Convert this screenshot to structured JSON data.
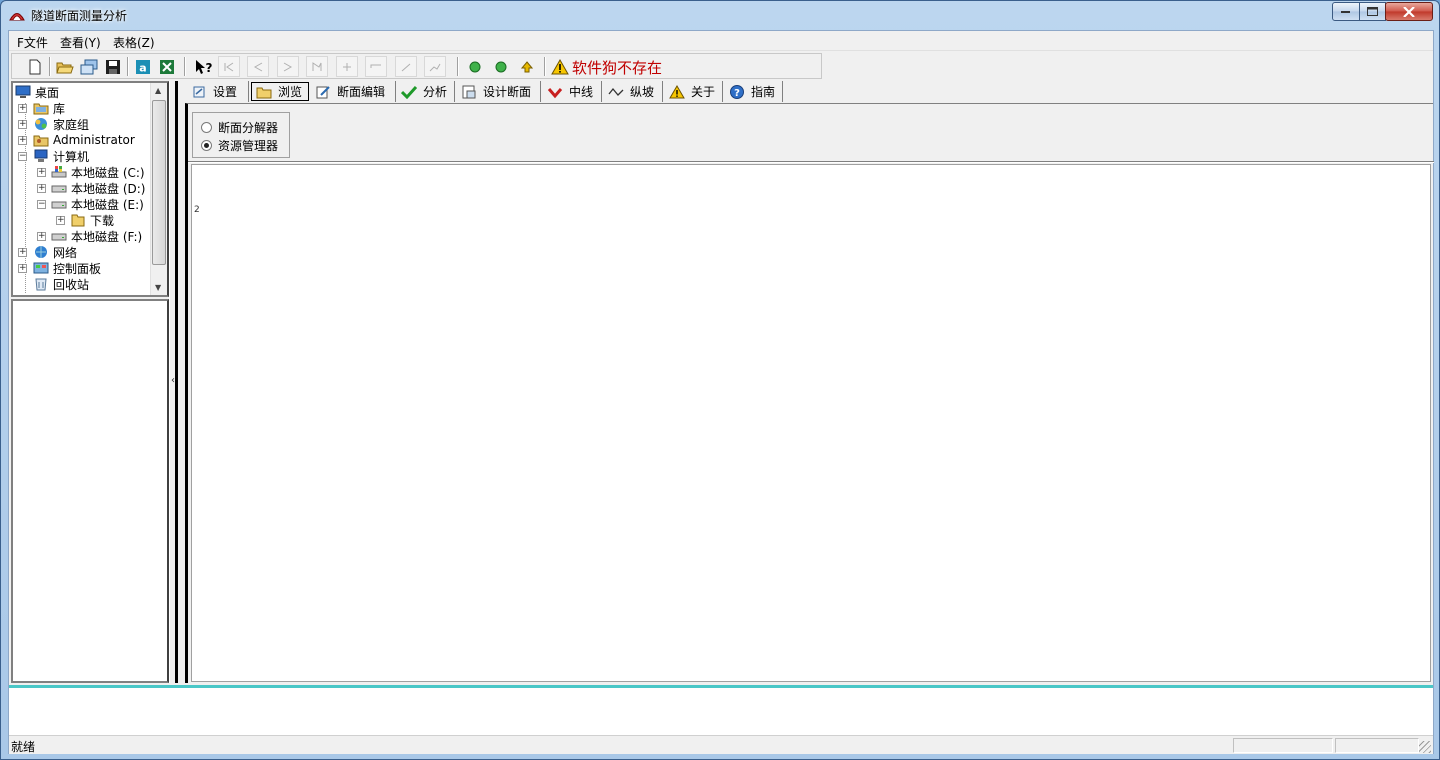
{
  "window": {
    "title": "隧道断面测量分析"
  },
  "menu": {
    "items": [
      "F文件",
      "查看(Y)",
      "表格(Z)"
    ]
  },
  "toolbar": {
    "buttons": [
      "new-file",
      "open-folder",
      "browse",
      "save",
      "text-a",
      "excel",
      "help-pointer",
      "first",
      "prev",
      "next",
      "last",
      "add-point",
      "line-h",
      "line-d",
      "curve",
      "green-1",
      "green-2",
      "up-arrow"
    ],
    "warning_text": "软件狗不存在"
  },
  "tree": {
    "items": [
      {
        "label": "桌面",
        "icon": "desktop-icon"
      },
      {
        "label": "库",
        "icon": "library-icon"
      },
      {
        "label": "家庭组",
        "icon": "homegroup-icon"
      },
      {
        "label": "Administrator",
        "icon": "user-folder-icon"
      },
      {
        "label": "计算机",
        "icon": "computer-icon"
      },
      {
        "label": "本地磁盘 (C:)",
        "icon": "system-drive-icon"
      },
      {
        "label": "本地磁盘 (D:)",
        "icon": "drive-icon"
      },
      {
        "label": "本地磁盘 (E:)",
        "icon": "drive-icon"
      },
      {
        "label": "下载",
        "icon": "folder-icon"
      },
      {
        "label": "本地磁盘 (F:)",
        "icon": "drive-icon"
      },
      {
        "label": "网络",
        "icon": "network-icon"
      },
      {
        "label": "控制面板",
        "icon": "control-panel-icon"
      },
      {
        "label": "回收站",
        "icon": "recycle-bin-icon"
      }
    ]
  },
  "tabs": [
    {
      "label": "设置",
      "icon": "settings-icon"
    },
    {
      "label": "浏览",
      "icon": "browse-icon",
      "active": true
    },
    {
      "label": "断面编辑",
      "icon": "edit-icon"
    },
    {
      "label": "分析",
      "icon": "check-icon"
    },
    {
      "label": "设计断面",
      "icon": "design-icon"
    },
    {
      "label": "中线",
      "icon": "centerline-icon"
    },
    {
      "label": "纵坡",
      "icon": "slope-icon"
    },
    {
      "label": "关于",
      "icon": "warning-icon"
    },
    {
      "label": "指南",
      "icon": "help-icon"
    }
  ],
  "browse": {
    "options": [
      {
        "label": "断面分解器",
        "checked": false
      },
      {
        "label": "资源管理器",
        "checked": true
      }
    ],
    "canvas_text": "2"
  },
  "status": {
    "text": "就绪"
  }
}
